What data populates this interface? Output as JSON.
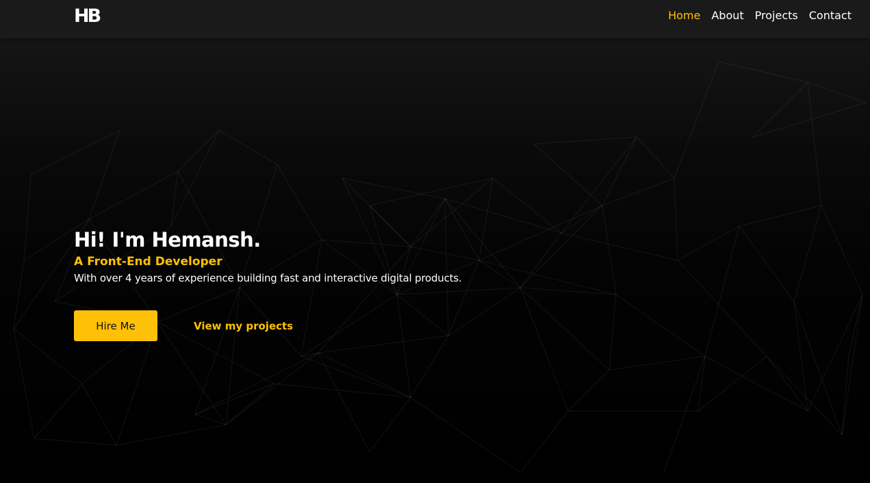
{
  "brand": {
    "logo_text": "HB"
  },
  "nav": {
    "items": [
      {
        "label": "Home",
        "active": true
      },
      {
        "label": "About",
        "active": false
      },
      {
        "label": "Projects",
        "active": false
      },
      {
        "label": "Contact",
        "active": false
      }
    ]
  },
  "hero": {
    "title": "Hi! I'm Hemansh.",
    "subtitle": "A Front-End Developer",
    "description": "With over 4 years of experience building fast and interactive digital products.",
    "primary_button": "Hire Me",
    "secondary_link": "View my projects"
  },
  "colors": {
    "accent": "#ffc107",
    "navbar_bg": "#1a1a1a",
    "text": "#ffffff"
  }
}
